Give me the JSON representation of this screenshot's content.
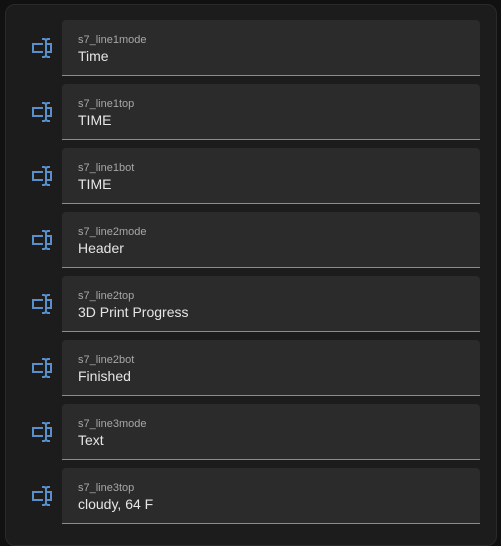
{
  "colors": {
    "icon": "#5b8fc9",
    "field_bg": "#2b2b2b",
    "card_bg": "#1c1c1c",
    "label": "#a7a7a7",
    "value": "#e6e6e6"
  },
  "entities": [
    {
      "icon": "form-textbox-icon",
      "label": "s7_line1mode",
      "value": "Time"
    },
    {
      "icon": "form-textbox-icon",
      "label": "s7_line1top",
      "value": "TIME"
    },
    {
      "icon": "form-textbox-icon",
      "label": "s7_line1bot",
      "value": "TIME"
    },
    {
      "icon": "form-textbox-icon",
      "label": "s7_line2mode",
      "value": "Header"
    },
    {
      "icon": "form-textbox-icon",
      "label": "s7_line2top",
      "value": "3D Print Progress"
    },
    {
      "icon": "form-textbox-icon",
      "label": "s7_line2bot",
      "value": "Finished"
    },
    {
      "icon": "form-textbox-icon",
      "label": "s7_line3mode",
      "value": "Text"
    },
    {
      "icon": "form-textbox-icon",
      "label": "s7_line3top",
      "value": "cloudy, 64 F"
    }
  ]
}
